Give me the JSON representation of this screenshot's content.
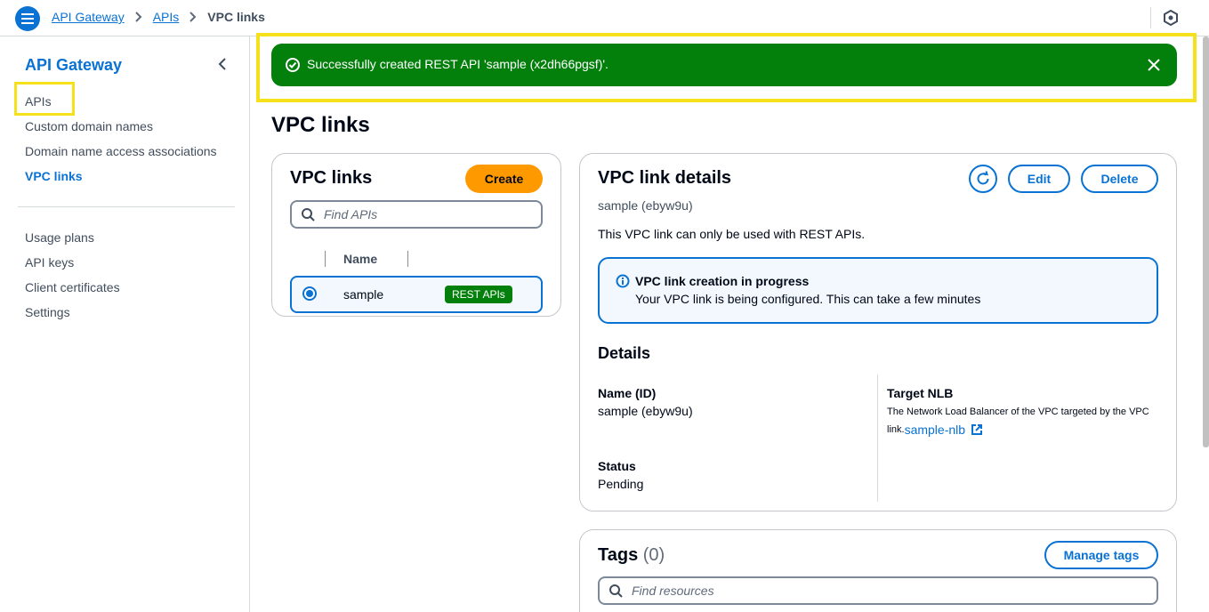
{
  "topbar": {
    "breadcrumbs": [
      "API Gateway",
      "APIs"
    ],
    "current": "VPC links"
  },
  "sidebar": {
    "title": "API Gateway",
    "items": [
      "APIs",
      "Custom domain names",
      "Domain name access associations",
      "VPC links"
    ],
    "items2": [
      "Usage plans",
      "API keys",
      "Client certificates",
      "Settings"
    ],
    "active": "VPC links"
  },
  "flash": {
    "message": "Successfully created REST API 'sample (x2dh66pgsf)'.",
    "type": "success"
  },
  "page": {
    "title": "VPC links"
  },
  "list_panel": {
    "title": "VPC links",
    "create_label": "Create",
    "search_placeholder": "Find APIs",
    "column_name": "Name",
    "rows": [
      {
        "name": "sample",
        "badge": "REST APIs",
        "selected": true
      }
    ]
  },
  "details_panel": {
    "title": "VPC link details",
    "subtitle": "sample (ebyw9u)",
    "edit_label": "Edit",
    "delete_label": "Delete",
    "description": "This VPC link can only be used with REST APIs.",
    "info_title": "VPC link creation in progress",
    "info_text": "Your VPC link is being configured. This can take a few minutes",
    "details_heading": "Details",
    "name_label": "Name (ID)",
    "name_value": "sample (ebyw9u)",
    "status_label": "Status",
    "status_value": "Pending",
    "target_label": "Target NLB",
    "target_desc_1": "The Network Load Balancer of the VPC targeted by the VPC",
    "target_desc_2": "link.",
    "target_link": "sample-nlb"
  },
  "tags_panel": {
    "title": "Tags",
    "count": "(0)",
    "manage_label": "Manage tags",
    "search_placeholder": "Find resources"
  },
  "colors": {
    "primary": "#0972d3",
    "success": "#037f0c",
    "create_button": "#ff9900",
    "highlight": "#f5e11b"
  }
}
